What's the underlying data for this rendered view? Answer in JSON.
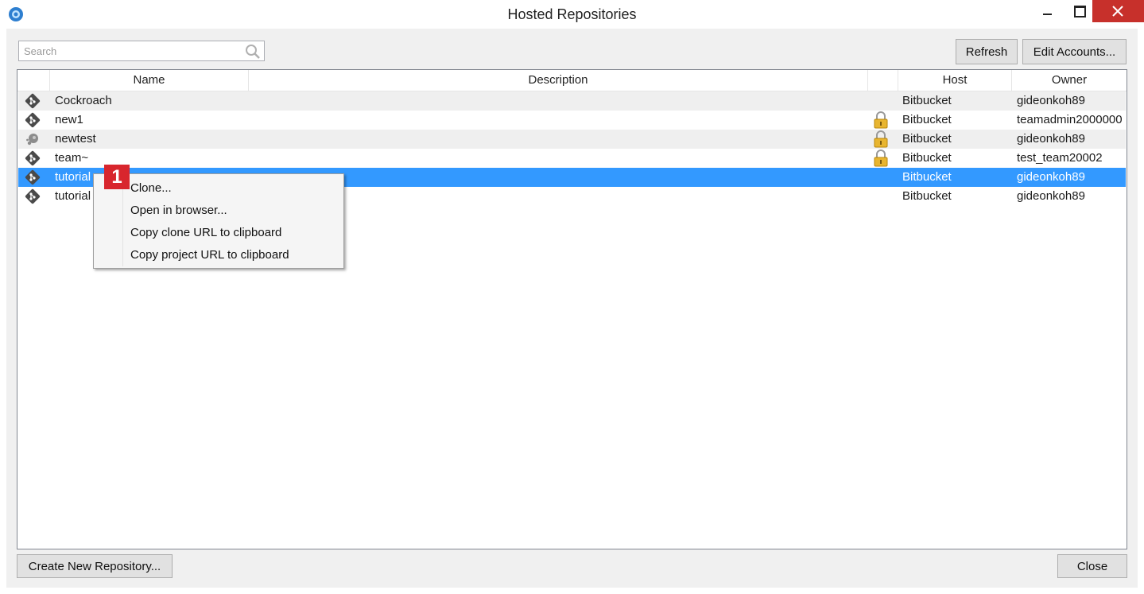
{
  "window": {
    "title": "Hosted Repositories",
    "close_color": "#c7302b"
  },
  "search": {
    "placeholder": "Search"
  },
  "toolbar": {
    "refresh_label": "Refresh",
    "edit_accounts_label": "Edit Accounts..."
  },
  "table": {
    "columns": [
      "Name",
      "Description",
      "Host",
      "Owner"
    ],
    "rows": [
      {
        "icon": "git-icon",
        "name": "Cockroach",
        "locked": false,
        "host": "Bitbucket",
        "owner": "gideonkoh89"
      },
      {
        "icon": "git-icon",
        "name": "new1",
        "locked": true,
        "host": "Bitbucket",
        "owner": "teamadmin2000000"
      },
      {
        "icon": "mercurial-icon",
        "name": "newtest",
        "locked": true,
        "host": "Bitbucket",
        "owner": "gideonkoh89"
      },
      {
        "icon": "git-icon",
        "name": "team~",
        "locked": true,
        "host": "Bitbucket",
        "owner": "test_team20002"
      },
      {
        "icon": "git-icon",
        "name": "tutorial",
        "locked": false,
        "host": "Bitbucket",
        "owner": "gideonkoh89",
        "selected": true
      },
      {
        "icon": "git-icon",
        "name": "tutorial",
        "locked": false,
        "host": "Bitbucket",
        "owner": "gideonkoh89"
      }
    ],
    "selected_color": "#3399ff"
  },
  "context_menu": {
    "items": [
      "Clone...",
      "Open in browser...",
      "Copy clone URL to clipboard",
      "Copy project URL to clipboard"
    ]
  },
  "callout": {
    "number": "1",
    "color": "#d8262d"
  },
  "footer": {
    "create_label": "Create New Repository...",
    "close_label": "Close"
  }
}
